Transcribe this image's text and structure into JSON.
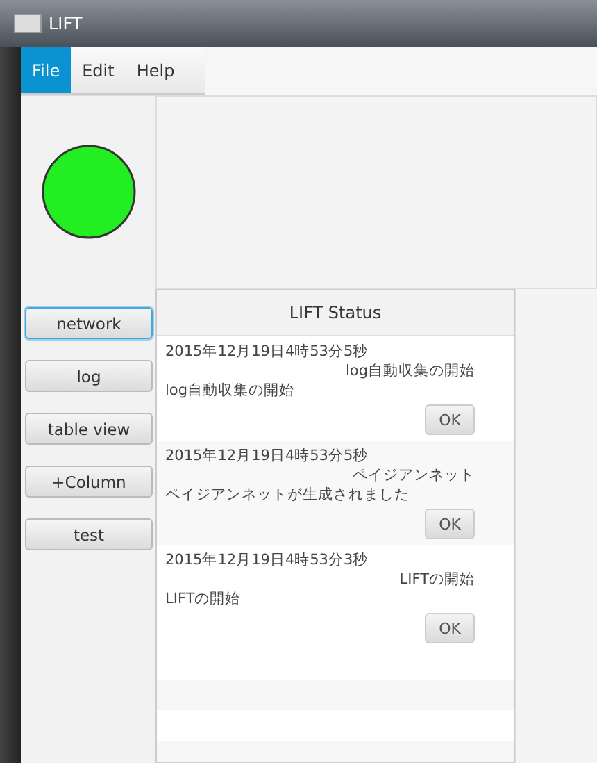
{
  "window": {
    "title": "LIFT"
  },
  "menu": [
    {
      "label": "File",
      "selected": true
    },
    {
      "label": "Edit",
      "selected": false
    },
    {
      "label": "Help",
      "selected": false
    }
  ],
  "status_indicator": {
    "color": "#22ee22"
  },
  "buttons": [
    {
      "label": "network",
      "focused": true
    },
    {
      "label": "log",
      "focused": false
    },
    {
      "label": "table view",
      "focused": false
    },
    {
      "label": "+Column",
      "focused": false
    },
    {
      "label": "test",
      "focused": false
    }
  ],
  "status_panel": {
    "title": "LIFT Status",
    "entries": [
      {
        "time": "2015年12月19日4時53分5秒",
        "source": "log自動収集の開始",
        "message": "log自動収集の開始",
        "button": "OK"
      },
      {
        "time": "2015年12月19日4時53分5秒",
        "source": "ペイジアンネット",
        "message": "ペイジアンネットが生成されました",
        "button": "OK"
      },
      {
        "time": "2015年12月19日4時53分3秒",
        "source": "LIFTの開始",
        "message": "LIFTの開始",
        "button": "OK"
      }
    ]
  }
}
